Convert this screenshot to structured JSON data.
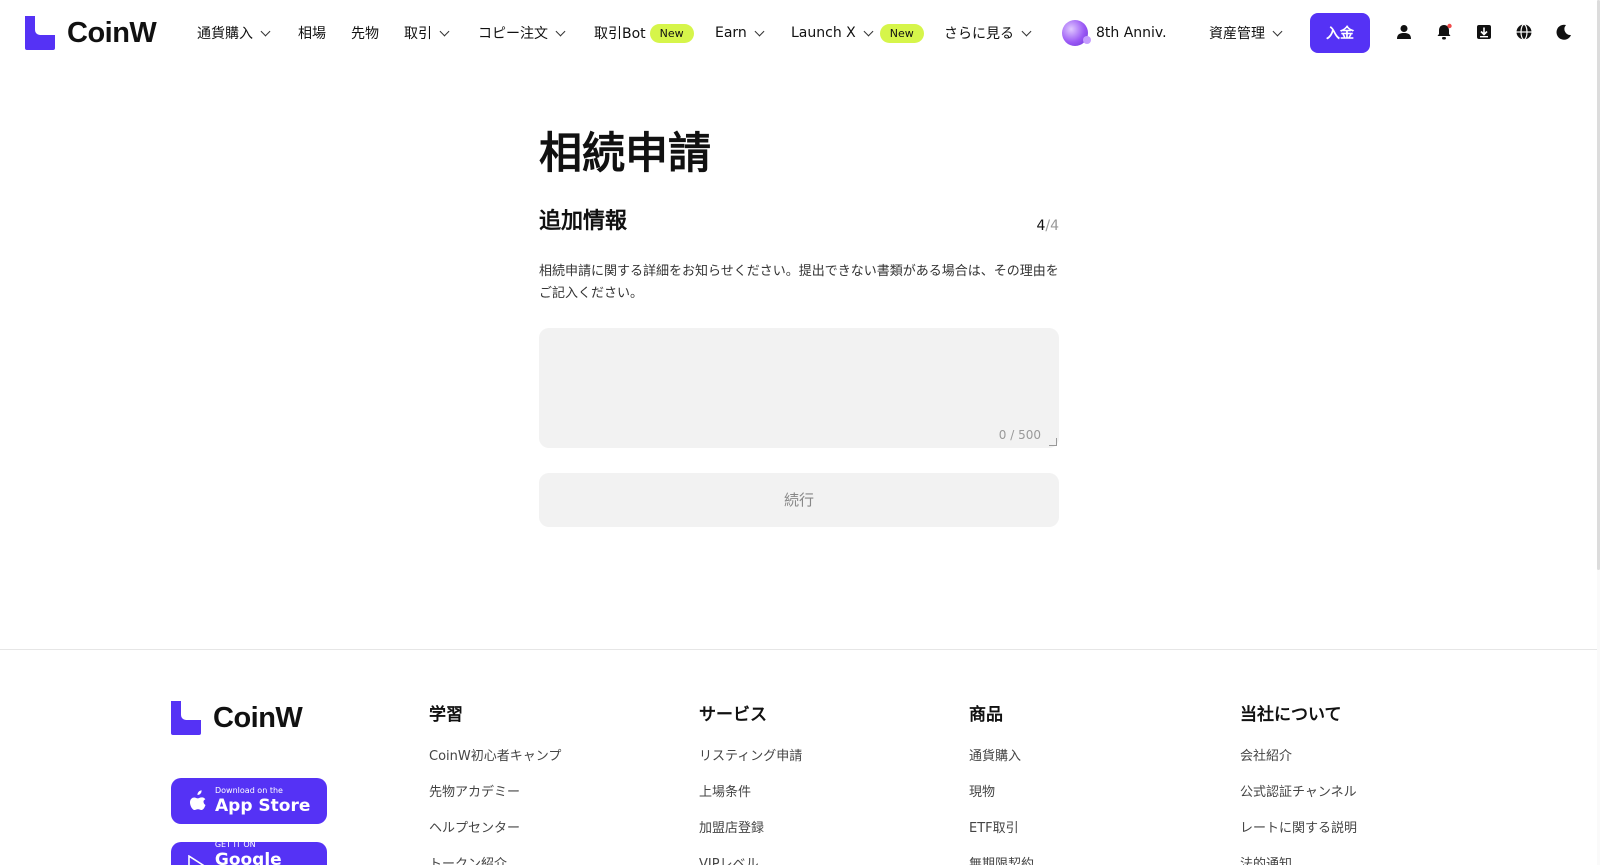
{
  "header": {
    "logo_text": "CoinW",
    "nav": [
      {
        "label": "通貨購入",
        "has_dropdown": true
      },
      {
        "label": "相場",
        "has_dropdown": false
      },
      {
        "label": "先物",
        "has_dropdown": false
      },
      {
        "label": "取引",
        "has_dropdown": true
      },
      {
        "label": "コピー注文",
        "has_dropdown": true
      },
      {
        "label": "取引Bot",
        "badge": "New"
      },
      {
        "label": "Earn",
        "has_dropdown": true
      },
      {
        "label": "Launch X",
        "has_dropdown": true,
        "badge": "New"
      },
      {
        "label": "さらに見る",
        "has_dropdown": true
      },
      {
        "label": "8th Anniv.",
        "has_dropdown": false
      },
      {
        "label": "資産管理",
        "has_dropdown": true
      }
    ],
    "deposit_label": "入金",
    "icons": [
      "user-icon",
      "bell-icon",
      "download-icon",
      "globe-icon",
      "moon-icon"
    ],
    "accent_color": "#5532f5",
    "badge_color": "#d6f54a"
  },
  "main": {
    "title": "相続申請",
    "section_title": "追加情報",
    "step_current": "4",
    "step_total": "/4",
    "description": "相続申請に関する詳細をお知らせください。提出できない書類がある場合は、その理由をご記入ください。",
    "textarea_value": "",
    "counter": "0 / 500",
    "continue_label": "続行"
  },
  "footer": {
    "logo_text": "CoinW",
    "app_store": {
      "small": "Download on the",
      "big": "App Store"
    },
    "google_play": {
      "small": "GET IT ON",
      "big": "Google Play"
    },
    "columns": [
      {
        "title": "学習",
        "links": [
          "CoinW初心者キャンプ",
          "先物アカデミー",
          "ヘルプセンター",
          "トークン紹介"
        ]
      },
      {
        "title": "サービス",
        "links": [
          "リスティング申請",
          "上場条件",
          "加盟店登録",
          "VIPレベル"
        ]
      },
      {
        "title": "商品",
        "links": [
          "通貨購入",
          "現物",
          "ETF取引",
          "無期限契約"
        ]
      },
      {
        "title": "当社について",
        "links": [
          "会社紹介",
          "公式認証チャンネル",
          "レートに関する説明",
          "法的通知"
        ]
      }
    ]
  }
}
